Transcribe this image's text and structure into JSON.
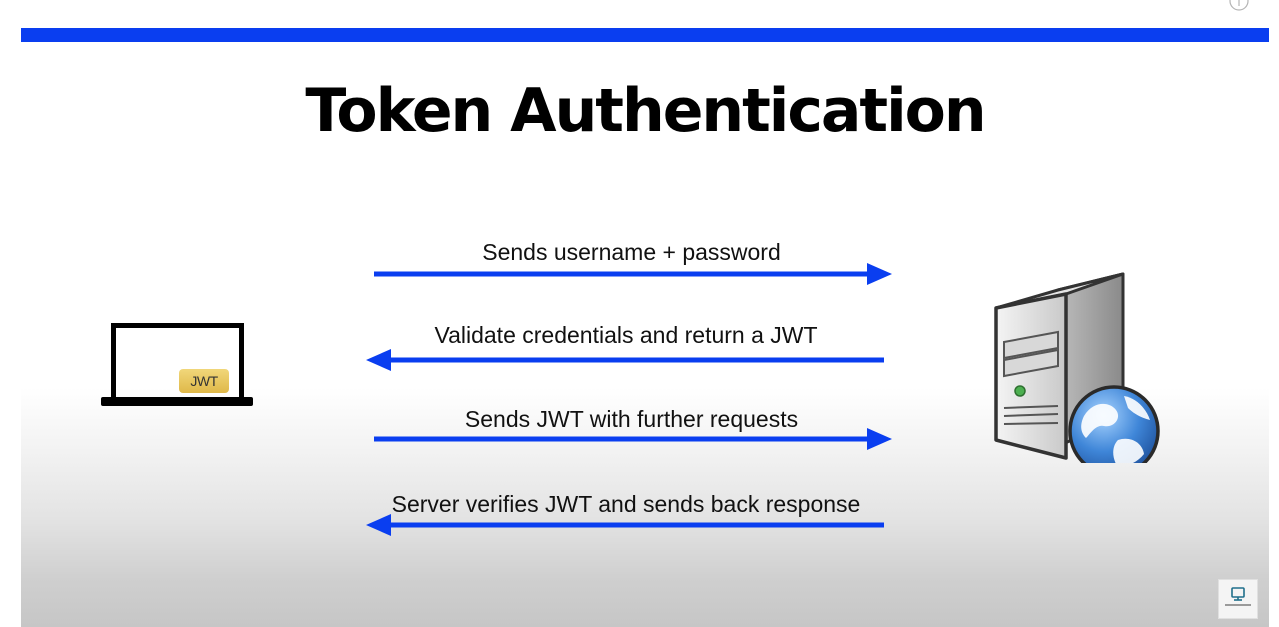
{
  "slide": {
    "title": "Token Authentication"
  },
  "client": {
    "badge_label": "JWT"
  },
  "flows": [
    {
      "label": "Sends username + password",
      "direction": "right"
    },
    {
      "label": "Validate credentials and return a JWT",
      "direction": "left"
    },
    {
      "label": "Sends JWT with further requests",
      "direction": "right"
    },
    {
      "label": "Server verifies JWT and sends back response",
      "direction": "left"
    }
  ],
  "colors": {
    "accent": "#0a3ef0",
    "arrow": "#0a3ef0",
    "badge": "#e8c55e"
  },
  "icons": {
    "client": "laptop-icon",
    "server": "server-globe-icon",
    "channel": "channel-logo-icon",
    "info": "info-icon"
  }
}
